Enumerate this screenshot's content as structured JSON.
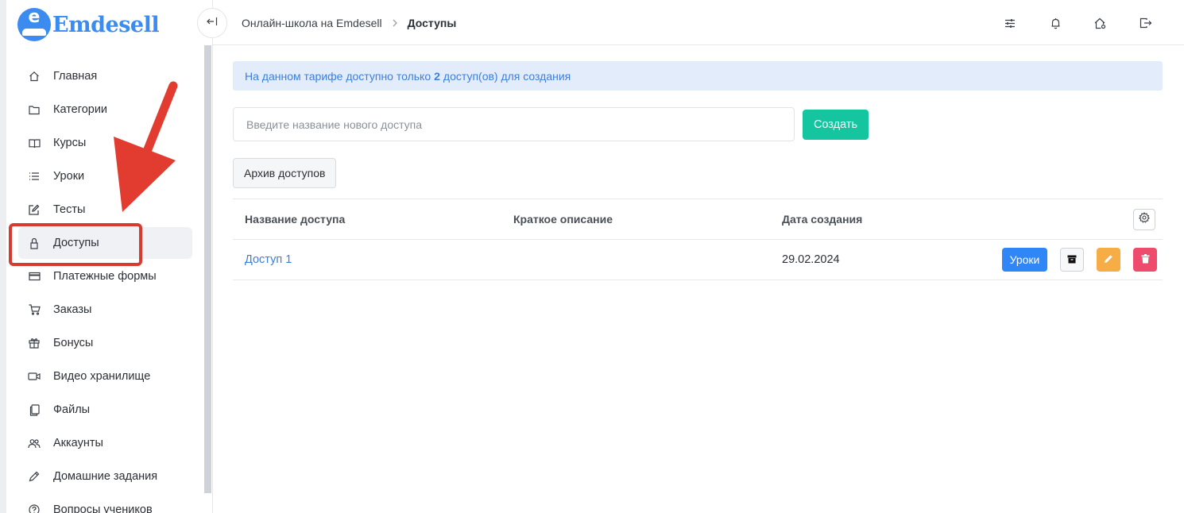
{
  "brand": {
    "name": "Emdesell",
    "logo_letter": "e"
  },
  "colors": {
    "accent": "#3b8bf1",
    "create": "#14c5a0",
    "edit": "#f6ad45",
    "delete": "#ef4b6c",
    "lessons": "#2f86f6",
    "highlight": "#d93a2f"
  },
  "sidebar": {
    "items": [
      {
        "label": "Главная",
        "icon": "home-icon"
      },
      {
        "label": "Категории",
        "icon": "folder-icon"
      },
      {
        "label": "Курсы",
        "icon": "book-icon"
      },
      {
        "label": "Уроки",
        "icon": "list-icon"
      },
      {
        "label": "Тесты",
        "icon": "edit-square-icon"
      },
      {
        "label": "Доступы",
        "icon": "lock-icon",
        "active": true
      },
      {
        "label": "Платежные формы",
        "icon": "card-icon"
      },
      {
        "label": "Заказы",
        "icon": "cart-icon"
      },
      {
        "label": "Бонусы",
        "icon": "gift-icon"
      },
      {
        "label": "Видео хранилище",
        "icon": "video-icon"
      },
      {
        "label": "Файлы",
        "icon": "files-icon"
      },
      {
        "label": "Аккаунты",
        "icon": "users-icon"
      },
      {
        "label": "Домашние задания",
        "icon": "pencil-icon"
      },
      {
        "label": "Вопросы учеников",
        "icon": "question-icon"
      }
    ]
  },
  "header": {
    "breadcrumb": {
      "parent": "Онлайн-школа на Emdesell",
      "current": "Доступы"
    },
    "icons": [
      "sliders-icon",
      "bell-icon",
      "house-gear-icon",
      "logout-icon"
    ]
  },
  "main": {
    "notice": {
      "prefix": "На данном тарифе доступно только",
      "count": "2",
      "suffix": "доступ(ов) для создания"
    },
    "create": {
      "placeholder": "Введите название нового доступа",
      "button": "Создать"
    },
    "archive_button": "Архив доступов",
    "table": {
      "columns": [
        "Название доступа",
        "Краткое описание",
        "Дата создания"
      ],
      "rows": [
        {
          "name": "Доступ 1",
          "description": "",
          "date": "29.02.2024",
          "lessons_label": "Уроки"
        }
      ]
    }
  }
}
